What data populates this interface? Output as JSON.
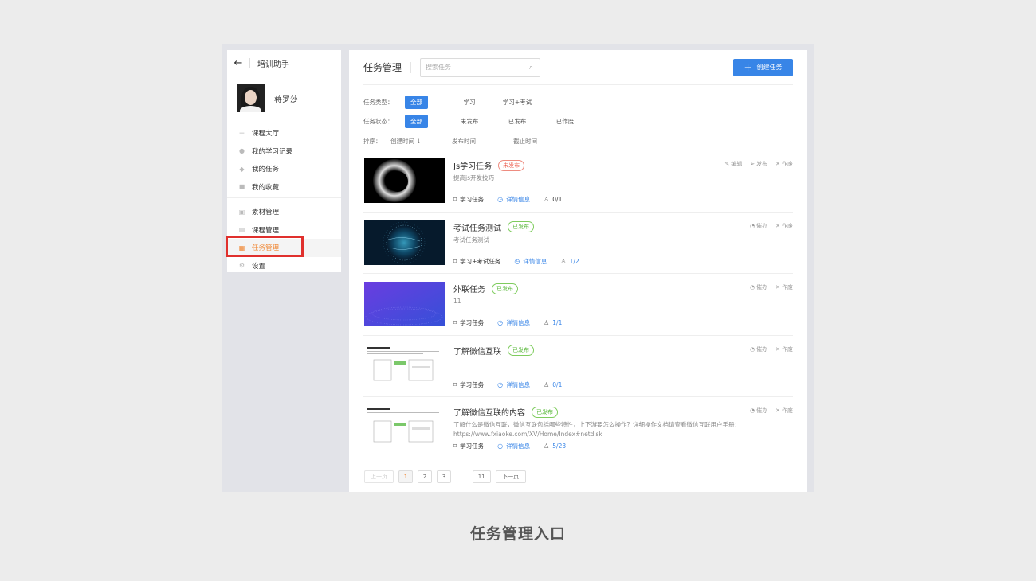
{
  "sidebar": {
    "back_icon": "arrow-left-icon",
    "title": "培训助手",
    "user": {
      "name": "蒋罗莎"
    },
    "group1": [
      {
        "label": "课程大厅",
        "icon": "list-icon"
      },
      {
        "label": "我的学习记录",
        "icon": "clock-icon"
      },
      {
        "label": "我的任务",
        "icon": "shield-icon"
      },
      {
        "label": "我的收藏",
        "icon": "folder-icon"
      }
    ],
    "group2": [
      {
        "label": "素材管理",
        "icon": "media-icon"
      },
      {
        "label": "课程管理",
        "icon": "book-icon"
      },
      {
        "label": "任务管理",
        "icon": "task-icon",
        "active": true
      },
      {
        "label": "设置",
        "icon": "gear-icon"
      }
    ]
  },
  "header": {
    "title": "任务管理",
    "search_placeholder": "搜索任务",
    "create_label": "创建任务"
  },
  "filters": {
    "type_label": "任务类型：",
    "type_options": [
      "全部",
      "学习",
      "学习+考试"
    ],
    "status_label": "任务状态：",
    "status_options": [
      "全部",
      "未发布",
      "已发布",
      "已作废"
    ],
    "sort_label": "排序：",
    "sort_options": [
      "创建时间",
      "发布时间",
      "截止时间"
    ],
    "sort_arrow": "↓"
  },
  "tasks": [
    {
      "name": "Js学习任务",
      "status": "未发布",
      "desc": "提高js开发技巧",
      "type": "学习任务",
      "detail": "详情信息",
      "count": "0/1",
      "actions": [
        "编辑",
        "发布",
        "作废"
      ]
    },
    {
      "name": "考试任务测试",
      "status": "已发布",
      "desc": "考试任务测试",
      "type": "学习+考试任务",
      "detail": "详情信息",
      "count": "1/2",
      "actions": [
        "催办",
        "作废"
      ]
    },
    {
      "name": "外联任务",
      "status": "已发布",
      "desc": "11",
      "type": "学习任务",
      "detail": "详情信息",
      "count": "1/1",
      "actions": [
        "催办",
        "作废"
      ]
    },
    {
      "name": "了解微信互联",
      "status": "已发布",
      "desc": "",
      "type": "学习任务",
      "detail": "详情信息",
      "count": "0/1",
      "actions": [
        "催办",
        "作废"
      ]
    },
    {
      "name": "了解微信互联的内容",
      "status": "已发布",
      "desc": "了解什么是微信互联，微信互联包括哪些特性，上下游要怎么操作？详细操作文档请查看微信互联用户手册：https://www.fxiaoke.com/XV/Home/Index#netdisk",
      "type": "学习任务",
      "detail": "详情信息",
      "count": "5/23",
      "actions": [
        "催办",
        "作废"
      ]
    }
  ],
  "pagination": {
    "prev": "上一页",
    "pages": [
      "1",
      "2",
      "3",
      "...",
      "11"
    ],
    "current": "1",
    "next": "下一页"
  },
  "caption": "任务管理入口",
  "colors": {
    "accent": "#3885e7",
    "active": "#f08632",
    "highlight_box": "#e0302d",
    "unpublished": "#ee6a5c",
    "published": "#5bb93c"
  }
}
